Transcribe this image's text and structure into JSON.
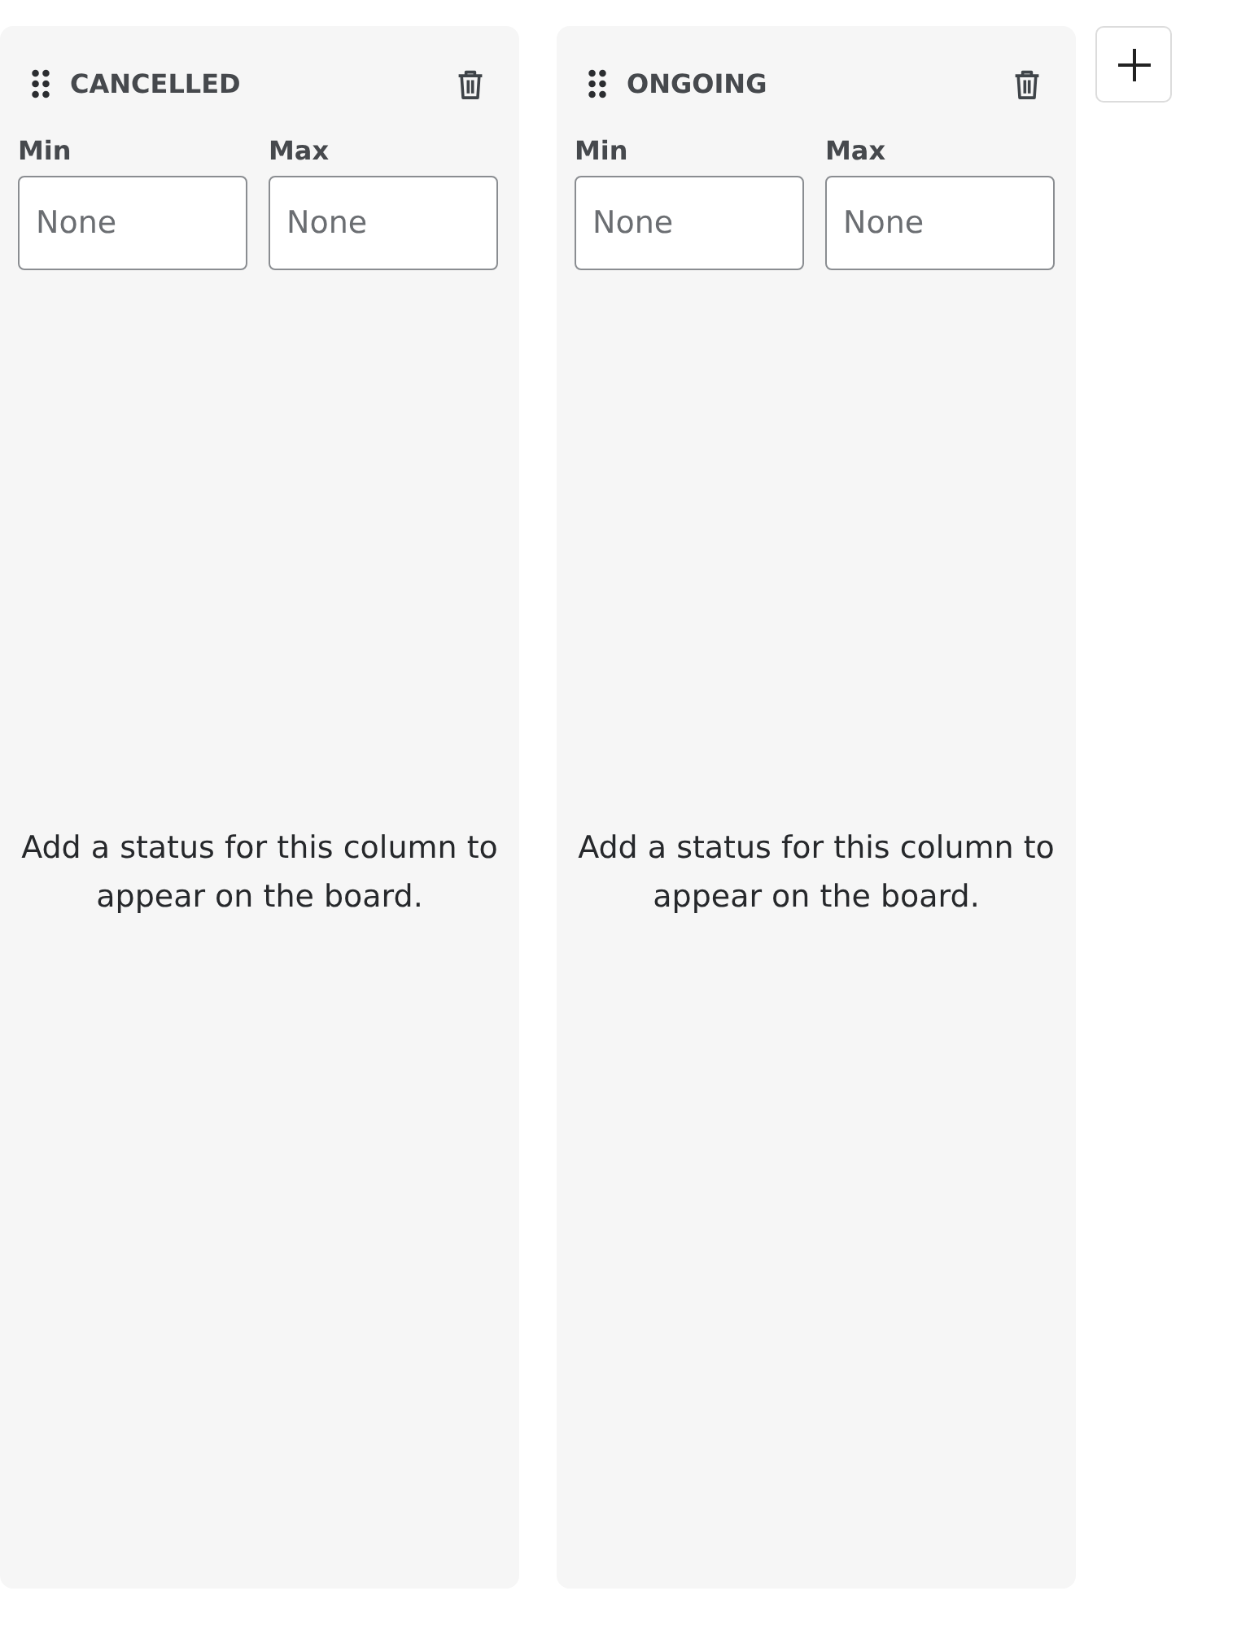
{
  "columns": [
    {
      "title": "CANCELLED",
      "min": {
        "label": "Min",
        "placeholder": "None"
      },
      "max": {
        "label": "Max",
        "placeholder": "None"
      },
      "message": "Add a status for this column to appear on the board."
    },
    {
      "title": "ONGOING",
      "min": {
        "label": "Min",
        "placeholder": "None"
      },
      "max": {
        "label": "Max",
        "placeholder": "None"
      },
      "message": "Add a status for this column to appear on the board."
    }
  ]
}
